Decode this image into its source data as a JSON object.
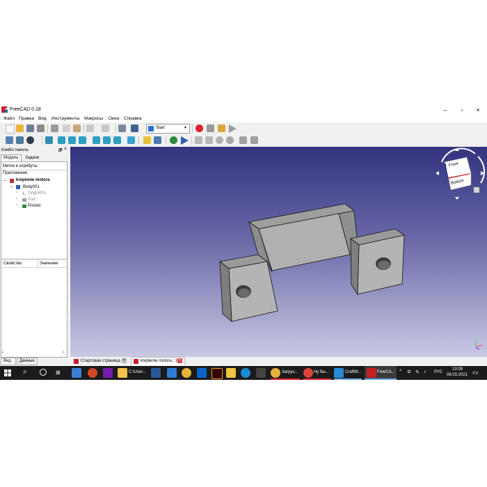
{
  "window": {
    "title": "FreeCAD 0.18"
  },
  "menu": [
    "Файл",
    "Правка",
    "Вид",
    "Инструменты",
    "Макросы",
    "Окна",
    "Справка"
  ],
  "toolbar": {
    "workbench": "Start"
  },
  "combo": {
    "title": "Комбо панель",
    "tabs": [
      "Модель",
      "Задачи"
    ],
    "labels_header": "Метки и атрибуты",
    "app_label": "Приложение",
    "tree": [
      "kreplenie motora",
      "Body001",
      "Origin001",
      "Pad",
      "Pocket"
    ],
    "prop_col1": "Свойство",
    "prop_col2": "Значение",
    "bottom_tabs": [
      "Вид",
      "Данные"
    ]
  },
  "navcube": {
    "front": "Front",
    "bottom": "Bottom"
  },
  "doc_tabs": [
    "Стартовая страница",
    "kreplenie motora : 1"
  ],
  "taskbar": {
    "items": [
      "C:\\User...",
      "Загруз...",
      "Ну бы...",
      "CraftW...",
      "FreeCA..."
    ],
    "lang": "РУС",
    "time": "13:09",
    "date": "08.03.2021"
  },
  "colors": {
    "view_top": "#33337f",
    "view_bottom": "#c9c9e4",
    "taskbar": "#1b1b1b",
    "record": "#e0212b"
  }
}
